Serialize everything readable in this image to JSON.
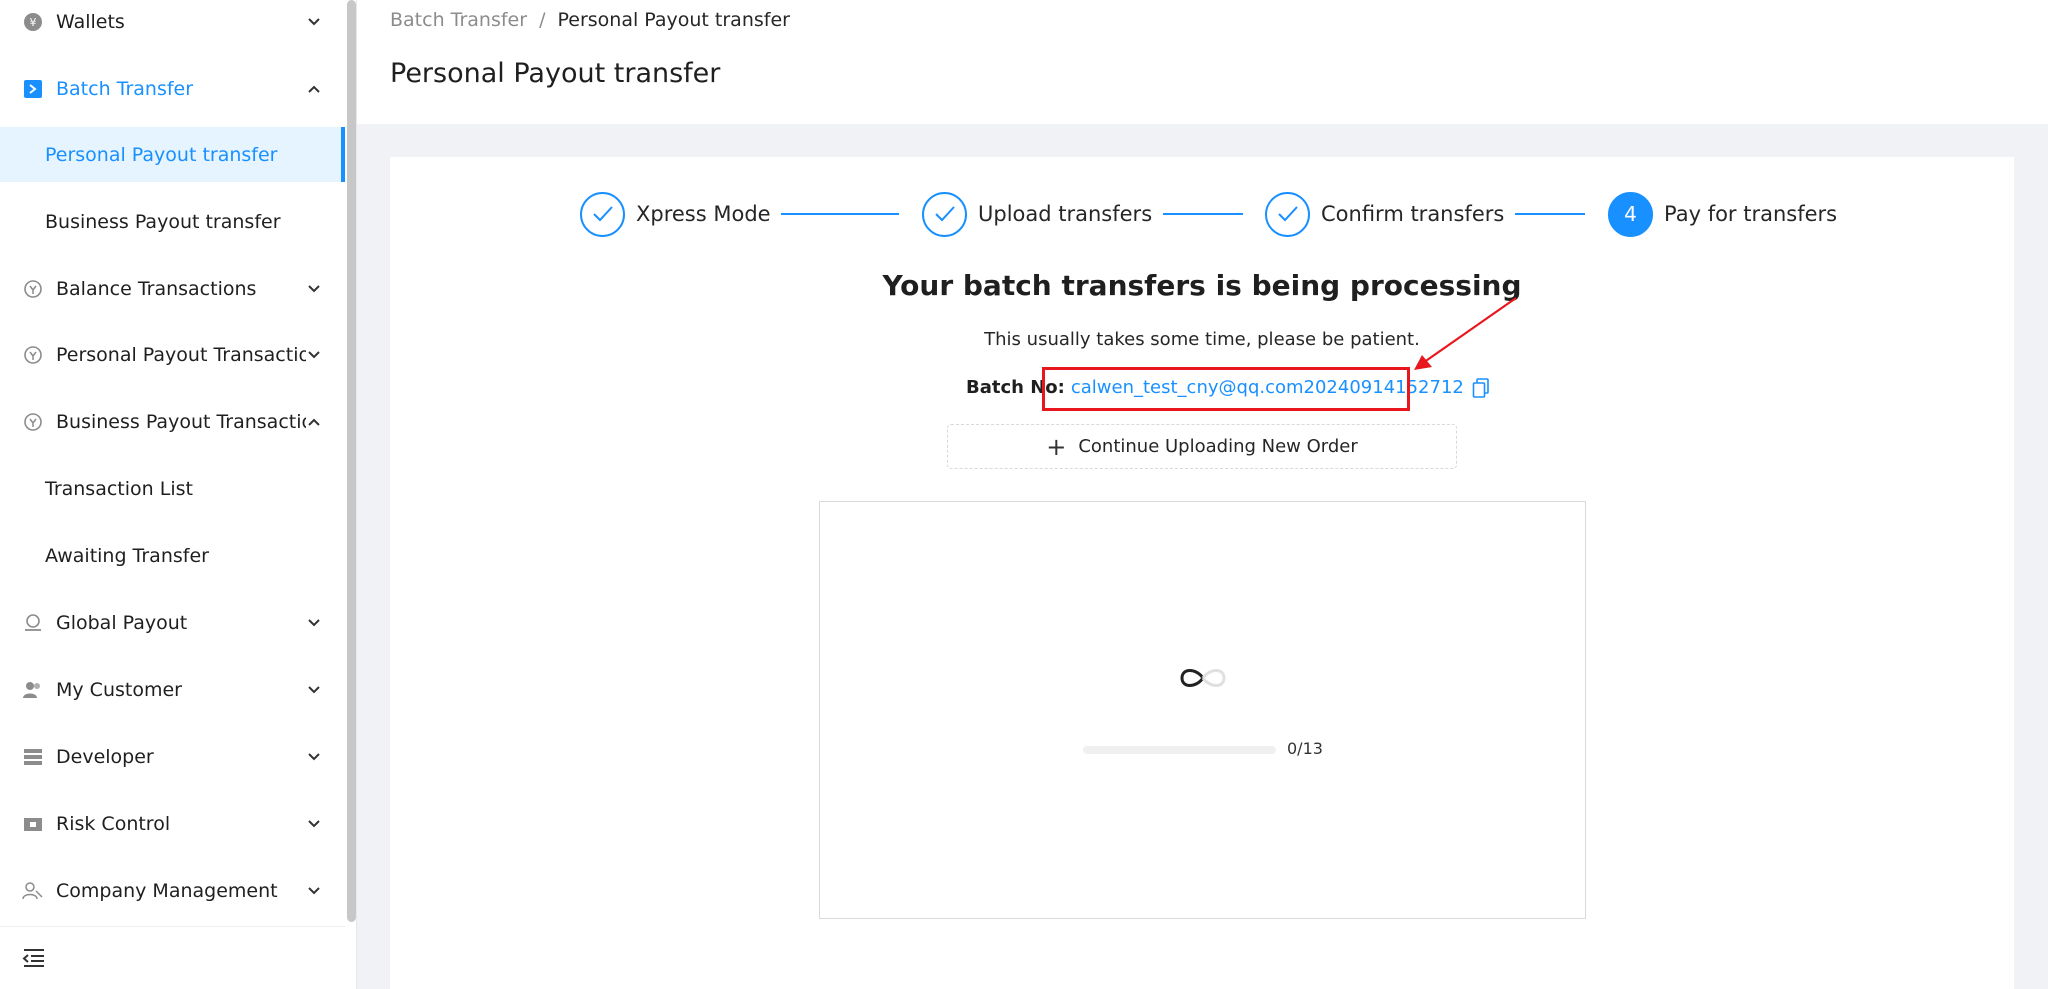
{
  "sidebar": {
    "items": [
      {
        "label": "Wallets",
        "icon": "yen-coin-icon",
        "expanded": false
      },
      {
        "label": "Batch Transfer",
        "icon": "batch-transfer-icon",
        "expanded": true,
        "active": true
      },
      {
        "label": "Balance Transactions",
        "icon": "transactions-icon",
        "expanded": false
      },
      {
        "label": "Personal Payout Transactions",
        "icon": "transactions-icon",
        "expanded": false
      },
      {
        "label": "Business Payout Transactions",
        "icon": "transactions-icon",
        "expanded": true
      },
      {
        "label": "Global Payout",
        "icon": "global-payout-icon",
        "expanded": false
      },
      {
        "label": "My Customer",
        "icon": "customers-icon",
        "expanded": false
      },
      {
        "label": "Developer",
        "icon": "server-icon",
        "expanded": false
      },
      {
        "label": "Risk Control",
        "icon": "risk-control-icon",
        "expanded": false
      },
      {
        "label": "Company Management",
        "icon": "company-icon",
        "expanded": false
      }
    ],
    "batch_sub": [
      {
        "label": "Personal Payout transfer",
        "selected": true
      },
      {
        "label": "Business Payout transfer",
        "selected": false
      }
    ],
    "business_sub": [
      {
        "label": "Transaction List"
      },
      {
        "label": "Awaiting Transfer"
      }
    ]
  },
  "header": {
    "breadcrumb_parent": "Batch Transfer",
    "breadcrumb_separator": "/",
    "breadcrumb_current": "Personal Payout transfer",
    "title": "Personal Payout transfer"
  },
  "steps": [
    {
      "label": "Xpress Mode",
      "status": "done"
    },
    {
      "label": "Upload transfers",
      "status": "done"
    },
    {
      "label": "Confirm transfers",
      "status": "done"
    },
    {
      "label": "Pay for transfers",
      "status": "current",
      "number": "4"
    }
  ],
  "processing": {
    "title": "Your batch transfers is being processing",
    "subtitle": "This usually takes some time, please be patient.",
    "batch_label": "Batch No:",
    "batch_value": "calwen_test_cny@qq.com20240914152712",
    "upload_button": "Continue Uploading New Order",
    "progress_text": "0/13",
    "progress_fraction": 0
  },
  "colors": {
    "accent": "#1890ff",
    "highlight": "#e8171d"
  }
}
